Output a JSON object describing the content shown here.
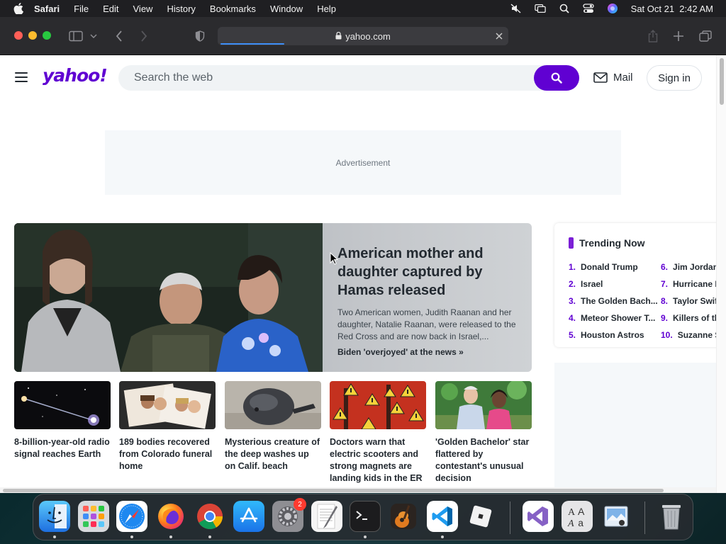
{
  "menubar": {
    "app_name": "Safari",
    "items": [
      "File",
      "Edit",
      "View",
      "History",
      "Bookmarks",
      "Window",
      "Help"
    ],
    "datetime": "Sat Oct 21  2:42 AM"
  },
  "browser": {
    "url": "yahoo.com"
  },
  "header": {
    "logo": "yahoo!",
    "search_placeholder": "Search the web",
    "mail_label": "Mail",
    "signin_label": "Sign in"
  },
  "ad": {
    "label": "Advertisement"
  },
  "hero": {
    "title": "American mother and daughter captured by Hamas released",
    "description": "Two American women, Judith Raanan and her daughter, Natalie Raanan, were released to the Red Cross and are now back in Israel,...",
    "link": "Biden 'overjoyed' at the news »"
  },
  "cards": [
    {
      "caption": "8-billion-year-old radio signal reaches Earth"
    },
    {
      "caption": "189 bodies recovered from Colorado funeral home"
    },
    {
      "caption": "Mysterious creature of the deep washes up on Calif. beach"
    },
    {
      "caption": "Doctors warn that electric scooters and strong magnets are landing kids in the ER"
    },
    {
      "caption": "'Golden Bachelor' star flattered by contestant's unusual decision"
    }
  ],
  "trending": {
    "title": "Trending Now",
    "items": [
      {
        "num": "1.",
        "text": "Donald Trump"
      },
      {
        "num": "2.",
        "text": "Israel"
      },
      {
        "num": "3.",
        "text": "The Golden Bach..."
      },
      {
        "num": "4.",
        "text": "Meteor Shower T..."
      },
      {
        "num": "5.",
        "text": "Houston Astros"
      },
      {
        "num": "6.",
        "text": "Jim Jordan"
      },
      {
        "num": "7.",
        "text": "Hurricane N"
      },
      {
        "num": "8.",
        "text": "Taylor Swift"
      },
      {
        "num": "9.",
        "text": "Killers of th"
      },
      {
        "num": "10.",
        "text": "Suzanne S"
      }
    ]
  },
  "dock": {
    "settings_badge": "2",
    "apps": [
      "finder-icon",
      "launchpad-icon",
      "safari-icon",
      "firefox-icon",
      "chrome-icon",
      "app-store-icon",
      "system-settings-icon",
      "textedit-icon",
      "terminal-icon",
      "garageband-icon",
      "vscode-icon",
      "roblox-icon",
      "visual-studio-icon",
      "font-book-icon",
      "preview-icon",
      "trash-icon"
    ]
  },
  "colors": {
    "yahoo_purple": "#6001d2",
    "safari_toolbar": "#2b2b2e",
    "menubar": "#1f1f22"
  }
}
